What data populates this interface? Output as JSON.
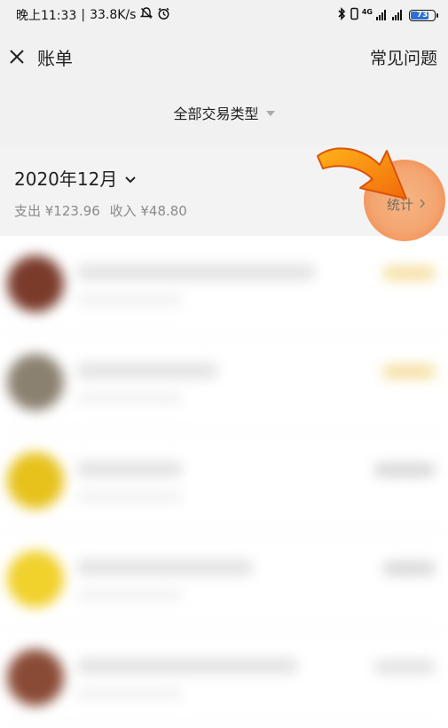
{
  "status_bar": {
    "time": "晚上11:33",
    "separator": "|",
    "speed": "33.8K/s",
    "network_label": "4G",
    "battery_level": "73"
  },
  "nav": {
    "title": "账单",
    "faq_label": "常见问题"
  },
  "filter": {
    "label": "全部交易类型"
  },
  "month": {
    "label": "2020年12月",
    "expense": "支出 ¥123.96",
    "income": "收入 ¥48.80",
    "stats_label": "统计"
  },
  "transactions": [
    {
      "avatar_color": "#7a3b2b",
      "amount_color": "#f6dfa2"
    },
    {
      "avatar_color": "#8b8170",
      "amount_color": "#f6dfa2"
    },
    {
      "avatar_color": "#e7c21c",
      "amount_color": "#d8d8d8"
    },
    {
      "avatar_color": "#f1d12c",
      "amount_color": "#d8d8d8"
    },
    {
      "avatar_color": "#8a4b36",
      "amount_color": "#e2e2e2"
    }
  ]
}
